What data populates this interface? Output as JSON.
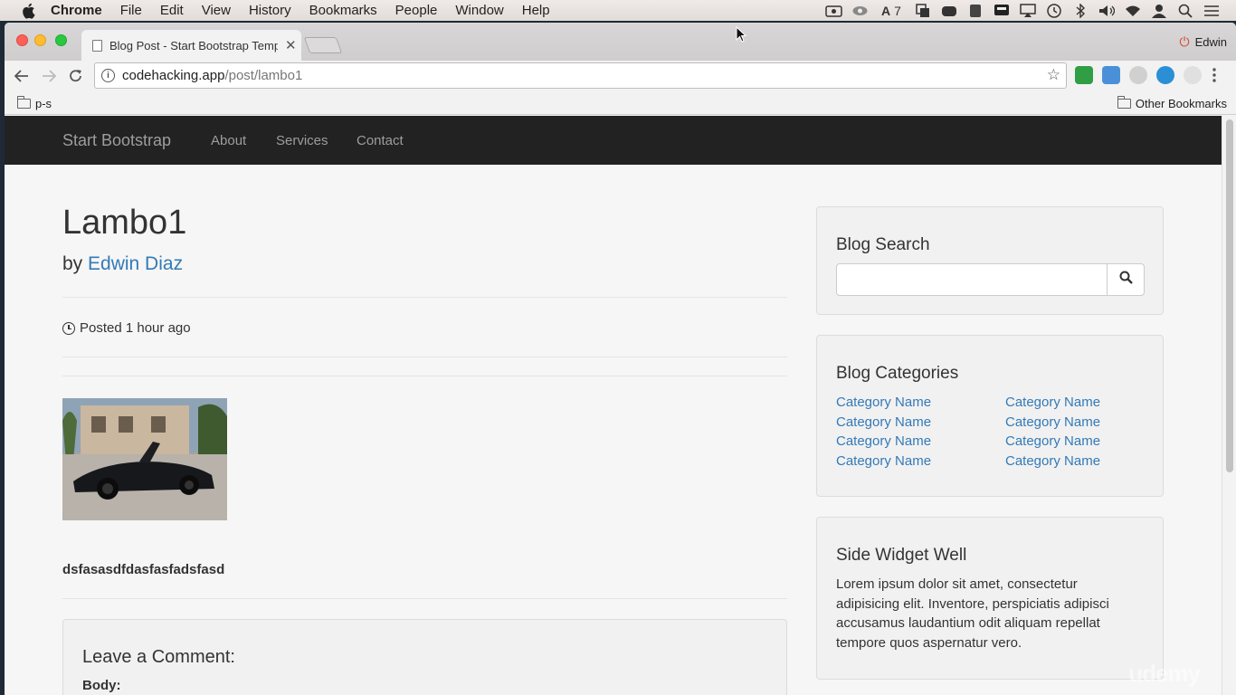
{
  "menubar": {
    "app": "Chrome",
    "items": [
      "File",
      "Edit",
      "View",
      "History",
      "Bookmarks",
      "People",
      "Window",
      "Help"
    ],
    "status_icons": [
      "facetime-icon",
      "eye-icon",
      "font-icon",
      "copy-icon",
      "gamepad-icon",
      "book-icon",
      "terminal-icon",
      "airplay-icon",
      "time-machine-icon",
      "bluetooth-icon",
      "volume-icon",
      "wifi-icon",
      "user-icon",
      "spotlight-icon",
      "list-icon"
    ],
    "font_badge": "7"
  },
  "browser": {
    "tab_title": "Blog Post - Start Bootstrap Template",
    "profile_name": "Edwin",
    "url_host": "codehacking.app",
    "url_path": "/post/lambo1",
    "bookmarks": {
      "left": "p-s",
      "right": "Other Bookmarks"
    }
  },
  "site": {
    "brand": "Start Bootstrap",
    "nav": [
      "About",
      "Services",
      "Contact"
    ]
  },
  "post": {
    "title": "Lambo1",
    "by_label": "by",
    "author": "Edwin Diaz",
    "posted": "Posted 1 hour ago",
    "body": "dsfasasdfdasfasfadsfasd",
    "comment_heading": "Leave a Comment:",
    "comment_body_label": "Body:"
  },
  "sidebar": {
    "search_heading": "Blog Search",
    "categories_heading": "Blog Categories",
    "categories_left": [
      "Category Name",
      "Category Name",
      "Category Name",
      "Category Name"
    ],
    "categories_right": [
      "Category Name",
      "Category Name",
      "Category Name",
      "Category Name"
    ],
    "widget_heading": "Side Widget Well",
    "widget_text": "Lorem ipsum dolor sit amet, consectetur adipisicing elit. Inventore, perspiciatis adipisci accusamus laudantium odit aliquam repellat tempore quos aspernatur vero."
  },
  "watermark": "udemy",
  "colors": {
    "link": "#337ab7",
    "navbar": "#222222",
    "navlink": "#9d9d9d"
  }
}
